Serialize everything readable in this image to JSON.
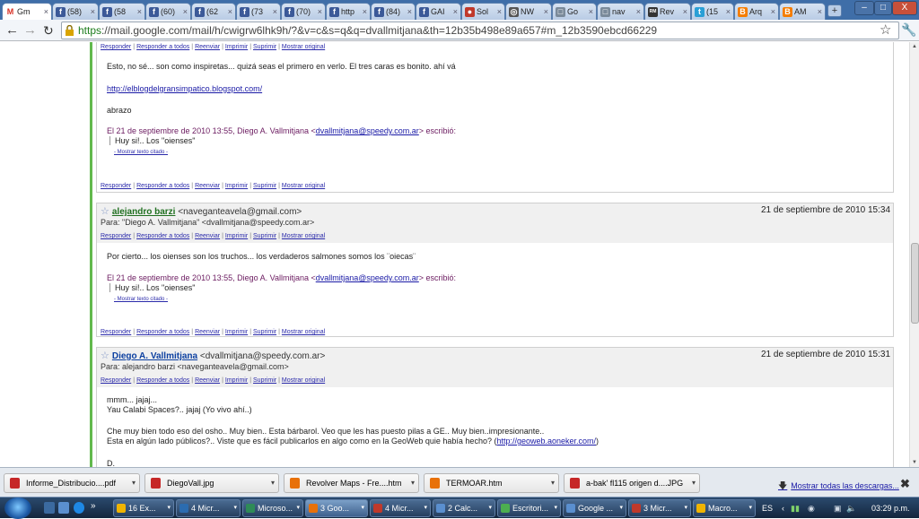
{
  "browser": {
    "tabs": [
      {
        "label": "Gm",
        "icon": "gmail-icon",
        "color": "#d93025",
        "glyph": "M",
        "active": true
      },
      {
        "label": "(58)",
        "icon": "facebook-icon",
        "color": "#3b5998",
        "glyph": "f"
      },
      {
        "label": "(58",
        "icon": "facebook-icon",
        "color": "#3b5998",
        "glyph": "f"
      },
      {
        "label": "(60)",
        "icon": "facebook-icon",
        "color": "#3b5998",
        "glyph": "f"
      },
      {
        "label": "(62",
        "icon": "facebook-icon",
        "color": "#3b5998",
        "glyph": "f"
      },
      {
        "label": "(73",
        "icon": "facebook-icon",
        "color": "#3b5998",
        "glyph": "f"
      },
      {
        "label": "(70)",
        "icon": "facebook-icon",
        "color": "#3b5998",
        "glyph": "f"
      },
      {
        "label": "http",
        "icon": "facebook-icon",
        "color": "#3b5998",
        "glyph": "f"
      },
      {
        "label": "(84)",
        "icon": "facebook-icon",
        "color": "#3b5998",
        "glyph": "f"
      },
      {
        "label": "GAI",
        "icon": "facebook-icon",
        "color": "#3b5998",
        "glyph": "f"
      },
      {
        "label": "Sol",
        "icon": "helmet-icon",
        "color": "#c0392b",
        "glyph": "●"
      },
      {
        "label": "NW",
        "icon": "globe-icon",
        "color": "#555555",
        "glyph": "◎"
      },
      {
        "label": "Go",
        "icon": "page-icon",
        "color": "#7a8a9a",
        "glyph": "□"
      },
      {
        "label": "nav",
        "icon": "page-icon",
        "color": "#7a8a9a",
        "glyph": "□"
      },
      {
        "label": "Rev",
        "icon": "rm-icon",
        "color": "#333333",
        "glyph": "RM"
      },
      {
        "label": "(15",
        "icon": "twitter-icon",
        "color": "#2a9fd6",
        "glyph": "t"
      },
      {
        "label": "Arq",
        "icon": "blogger-icon",
        "color": "#f57d00",
        "glyph": "B"
      },
      {
        "label": "AM",
        "icon": "blogger-icon",
        "color": "#f57d00",
        "glyph": "B"
      }
    ],
    "new_tab": "+",
    "window_buttons": [
      "–",
      "□",
      "X"
    ],
    "back": "←",
    "forward": "→",
    "reload": "C",
    "url_scheme": "https",
    "url_rest": "://mail.google.com/mail/h/cwigrw6lhk9h/?&v=c&s=q&q=dvallmitjana&th=12b35b498e89a657#m_12b3590ebcd66229",
    "star": "☆",
    "wrench": "🔧"
  },
  "actions": {
    "responder": "Responder",
    "responder_todos": "Responder a todos",
    "reenviar": "Reenviar",
    "imprimir": "Imprimir",
    "suprimir": "Suprimir",
    "mostrar_original": "Mostrar original",
    "sep": "|"
  },
  "messages": [
    {
      "body_lines": [
        "Esto, no sé...  son como inspiretas... quizá seas el primero en verlo. El tres caras es bonito. ahí vá"
      ],
      "link": "http://elblogdelgransimpatico.blogspot.com/",
      "closing": "abrazo",
      "quote_head_pre": "El 21 de septiembre de 2010 13:55, Diego A. Vallmitjana <",
      "quote_email": "dvallmitjana@speedy.com.ar",
      "quote_head_post": "> escribió:",
      "quote": "Huy si!.. Los \"oienses\"",
      "mostrar": "- Mostrar texto citado -"
    },
    {
      "sender": "alejandro barzi",
      "email": "<naveganteavela@gmail.com>",
      "date": "21 de septiembre de 2010 15:34",
      "to": "Para: \"Diego A. Vallmitjana\" <dvallmitjana@speedy.com.ar>",
      "body": "Por cierto...  los oienses son los truchos...     los verdaderos salmones somos los ¨oiecas¨",
      "quote_head_pre": "El 21 de septiembre de 2010 13:55, Diego A. Vallmitjana <",
      "quote_email": "dvallmitjana@speedy.com.ar",
      "quote_head_post": "> escribió:",
      "quote": "Huy si!.. Los \"oienses\"",
      "mostrar": "- Mostrar texto citado -"
    },
    {
      "sender": "Diego A. Vallmitjana",
      "email": "<dvallmitjana@speedy.com.ar>",
      "date": "21 de septiembre de 2010 15:31",
      "to": "Para: alejandro barzi <naveganteavela@gmail.com>",
      "line1": "mmm... jajaj...",
      "line2": "Yau Calabi Spaces?.. jajaj  (Yo vivo ahí..)",
      "line3": "Che muy bien todo eso del osho..  Muy bien.. Esta bárbarol. Veo que les has puesto pilas a GE.. Muy bien..impresionante..",
      "line4_pre": "Esta en algún lado públicos?.. Viste que es fácil publicarlos en algo como en la GeoWeb quie había hecho? (",
      "line4_link": "http://geoweb.aoneker.com/",
      "line4_post": ")",
      "line5": "D."
    }
  ],
  "downloads": {
    "items": [
      {
        "name": "Informe_Distribucio....pdf",
        "color": "#c62828"
      },
      {
        "name": "DiegoVall.jpg",
        "color": "#c62828"
      },
      {
        "name": "Revolver Maps - Fre....htm",
        "color": "#e8710a"
      },
      {
        "name": "TERMOAR.htm",
        "color": "#e8710a"
      },
      {
        "name": "a-bak' fl115 origen d....JPG",
        "color": "#c62828"
      }
    ],
    "show_all": "Mostrar todas las descargas...",
    "close": "✖"
  },
  "taskbar": {
    "items": [
      {
        "label": "16 Ex...",
        "color": "#f0b400"
      },
      {
        "label": "4 Micr...",
        "color": "#2b6cb0"
      },
      {
        "label": "Microso...",
        "color": "#2e8b57"
      },
      {
        "label": "3 Goo...",
        "color": "#e8710a",
        "active": true
      },
      {
        "label": "4 Micr...",
        "color": "#c0392b"
      },
      {
        "label": "2 Calc...",
        "color": "#5a8fcf"
      },
      {
        "label": "Escritori...",
        "color": "#4caf50"
      },
      {
        "label": "Google ...",
        "color": "#5a8fcf"
      },
      {
        "label": "3 Micr...",
        "color": "#c0392b"
      },
      {
        "label": "Macro...",
        "color": "#f0b400"
      }
    ],
    "overflow": "»",
    "lang": "ES",
    "clock": "03:29 p.m."
  }
}
